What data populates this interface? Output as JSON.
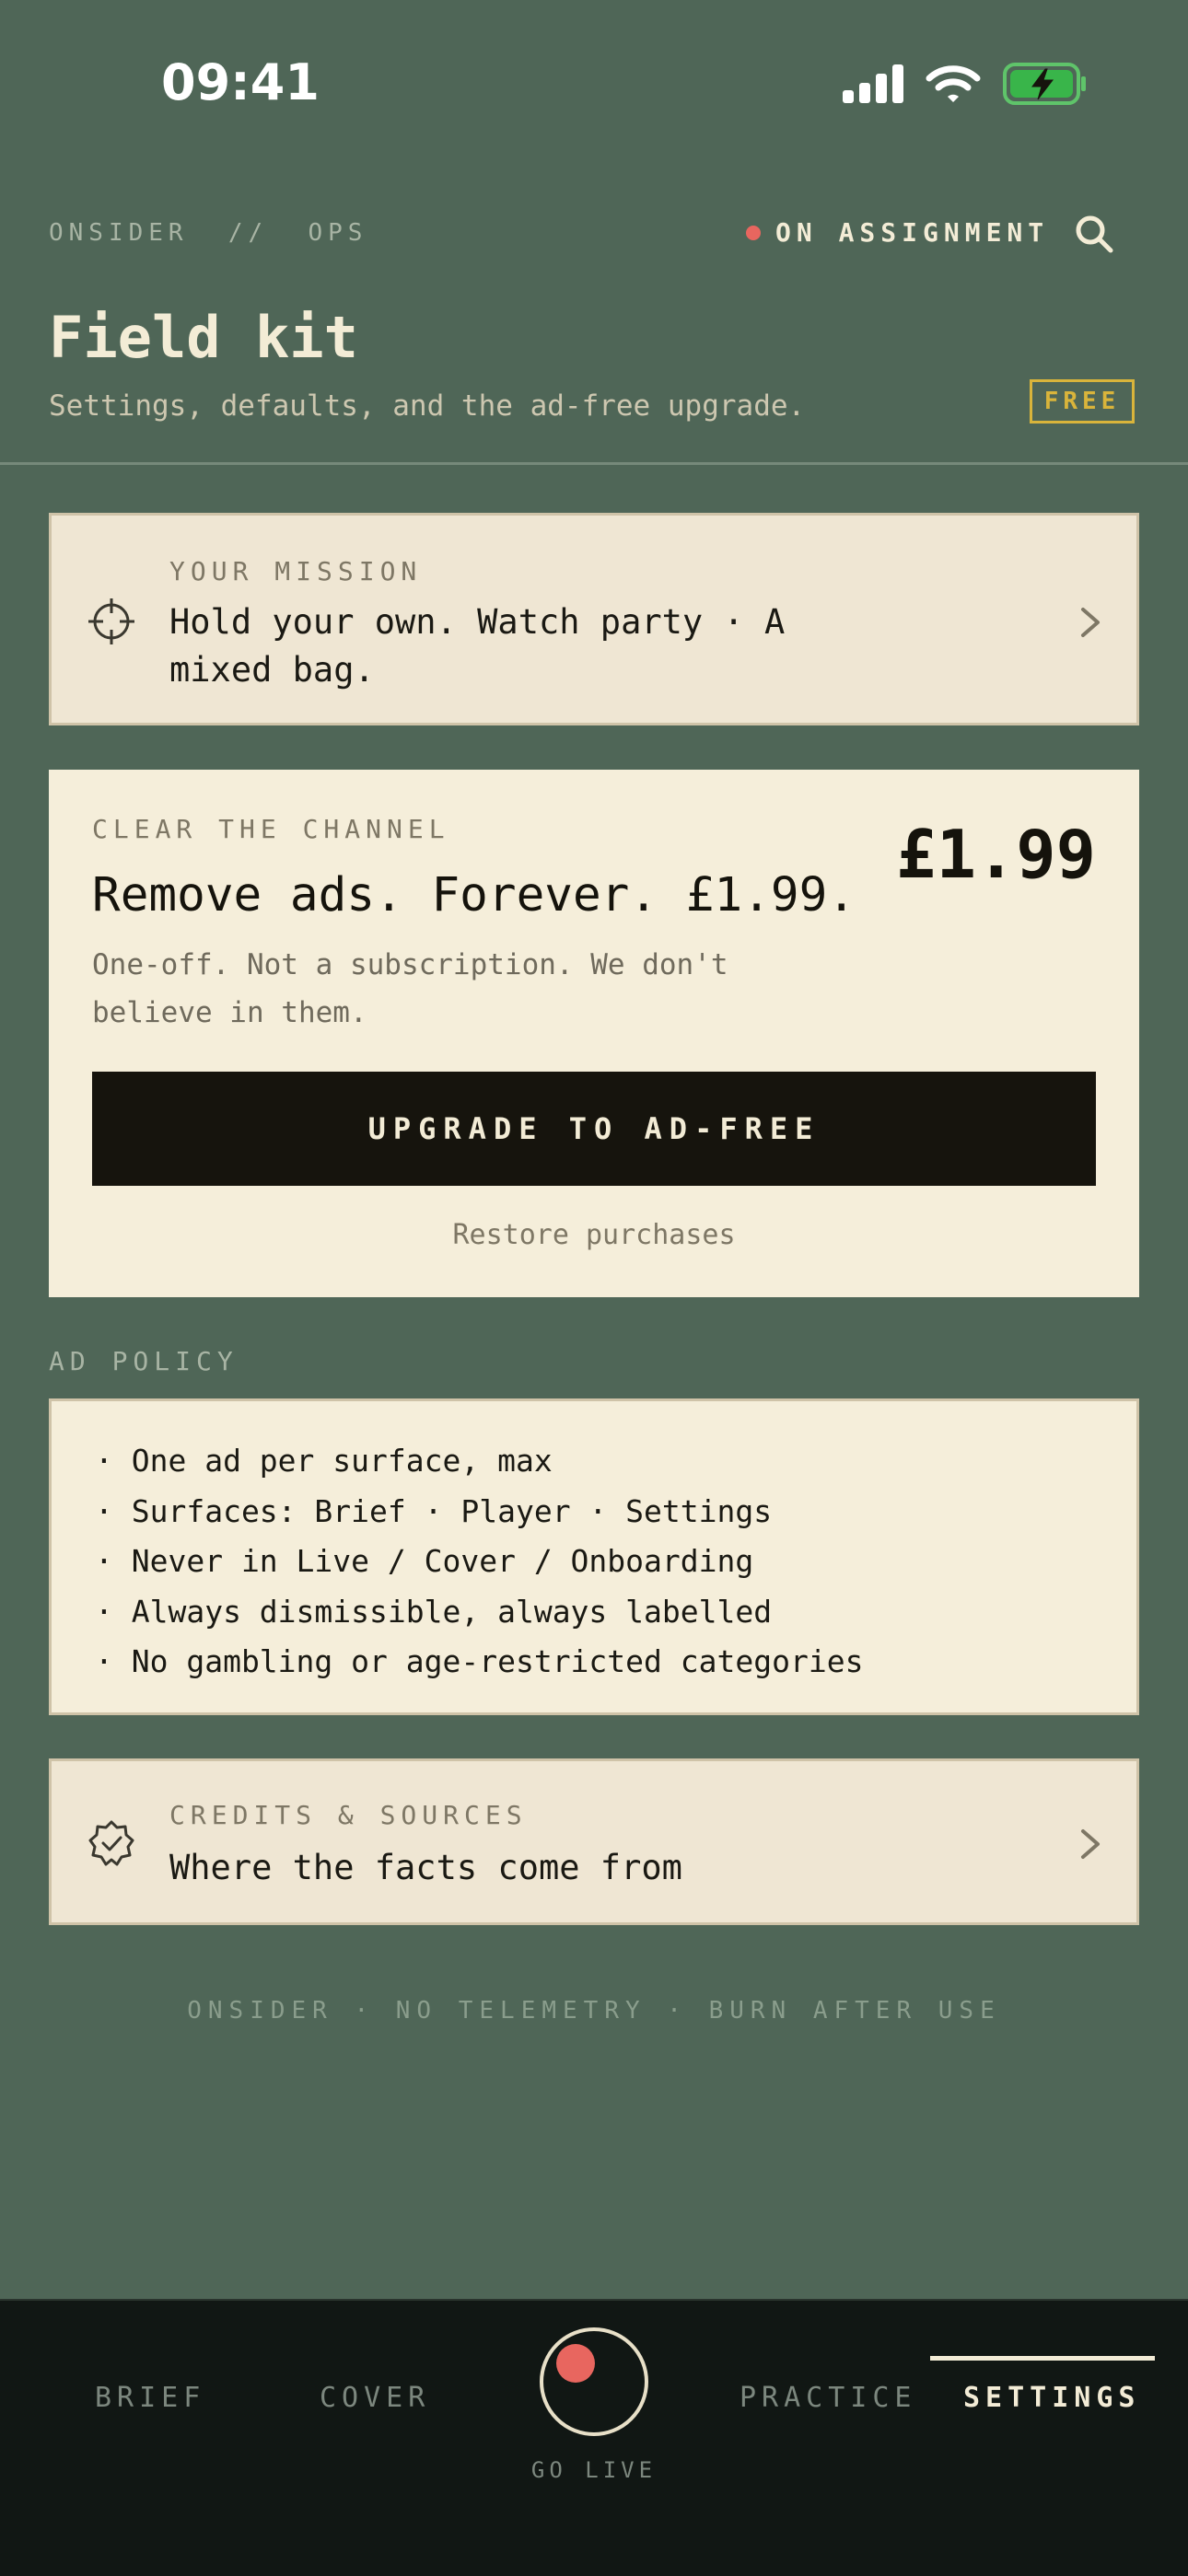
{
  "status_bar": {
    "time": "09:41"
  },
  "header": {
    "brand": "ONSIDER  //  OPS",
    "assignment_label": "ON ASSIGNMENT",
    "title": "Field kit",
    "subtitle": "Settings, defaults, and the ad-free upgrade.",
    "badge": "FREE"
  },
  "mission": {
    "eyebrow": "YOUR MISSION",
    "title": "Hold your own. Watch party · A mixed bag."
  },
  "upgrade": {
    "eyebrow": "CLEAR THE CHANNEL",
    "price": "£1.99",
    "headline": "Remove ads. Forever. £1.99.",
    "description": "One-off. Not a subscription. We don't believe in them.",
    "cta": "UPGRADE TO AD-FREE",
    "restore": "Restore purchases"
  },
  "ad_policy": {
    "label": "AD POLICY",
    "items": [
      "· One ad per surface, max",
      "· Surfaces: Brief · Player · Settings",
      "· Never in Live / Cover / Onboarding",
      "· Always dismissible, always labelled",
      "· No gambling or age-restricted categories"
    ]
  },
  "credits": {
    "eyebrow": "CREDITS & SOURCES",
    "title": "Where the facts come from"
  },
  "footer_note": "ONSIDER · NO TELEMETRY · BURN AFTER USE",
  "tabbar": {
    "tabs": [
      "BRIEF",
      "COVER",
      "PRACTICE",
      "SETTINGS"
    ],
    "active": "SETTINGS",
    "go_live": "GO LIVE"
  },
  "colors": {
    "background": "#4f6657",
    "accent_red": "#e8665f",
    "badge_gold": "#d9b43b",
    "card_cream": "#f5eeda",
    "tabbar": "#111714"
  }
}
